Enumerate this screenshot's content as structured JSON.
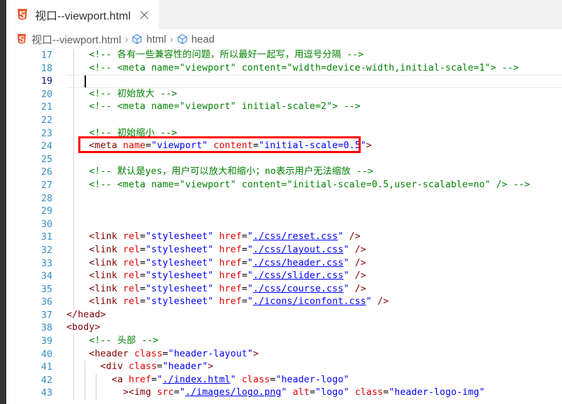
{
  "window": {
    "activity_bar_color": "#333333",
    "tab_bar_color": "#f3f3f3",
    "editor_background": "#ffffff"
  },
  "tab": {
    "icon": "html5-icon",
    "label": "视口--viewport.html",
    "close_icon": "close-icon",
    "active": true
  },
  "breadcrumb": {
    "file_icon": "html5-icon",
    "items": [
      {
        "label": "视口--viewport.html",
        "icon": "html5-icon"
      },
      {
        "label": "html",
        "icon": "symbol-cube-icon"
      },
      {
        "label": "head",
        "icon": "symbol-cube-icon"
      }
    ],
    "separator": "›"
  },
  "annotation": {
    "type": "red-rectangle-highlight",
    "color": "#ff0000",
    "target_line": 24
  },
  "editor": {
    "language": "html",
    "active_line": 19,
    "cursor": {
      "line": 19,
      "column": 2
    },
    "first_visible_line": 17,
    "last_visible_line": 43,
    "colors": {
      "line_number": "#3790c7",
      "active_line_number": "#0b216f",
      "comment": "#008000",
      "tag": "#800000",
      "attribute": "#e50000",
      "string": "#0000ff",
      "text": "#000000"
    },
    "lines": [
      {
        "no": "17",
        "indent": 1,
        "tokens": [
          {
            "c": "comment",
            "t": "    <!-- 各有一些兼容性的问题，所以最好一起写，用逗号分隔 -->"
          }
        ]
      },
      {
        "no": "18",
        "indent": 1,
        "tokens": [
          {
            "c": "comment",
            "t": "    <!-- <meta name=\"viewport\" content=\"width=device-width,initial-scale=1\"> -->"
          }
        ]
      },
      {
        "no": "19",
        "indent": 1,
        "active": true,
        "tokens": [
          {
            "c": "plain",
            "t": ""
          }
        ]
      },
      {
        "no": "20",
        "indent": 1,
        "tokens": [
          {
            "c": "comment",
            "t": "    <!-- 初始放大 -->"
          }
        ]
      },
      {
        "no": "21",
        "indent": 1,
        "tokens": [
          {
            "c": "comment",
            "t": "    <!-- <meta name=\"viewport\" initial-scale=2\"> -->"
          }
        ]
      },
      {
        "no": "22",
        "indent": 1,
        "tokens": [
          {
            "c": "plain",
            "t": ""
          }
        ]
      },
      {
        "no": "23",
        "indent": 1,
        "tokens": [
          {
            "c": "comment",
            "t": "    <!-- 初始缩小 -->"
          }
        ]
      },
      {
        "no": "24",
        "indent": 1,
        "highlighted": true,
        "tokens": [
          {
            "c": "plain",
            "t": "    "
          },
          {
            "c": "punct",
            "t": "<"
          },
          {
            "c": "tag",
            "t": "meta"
          },
          {
            "c": "plain",
            "t": " "
          },
          {
            "c": "attr",
            "t": "name"
          },
          {
            "c": "plain",
            "t": "="
          },
          {
            "c": "str",
            "t": "\"viewport\""
          },
          {
            "c": "plain",
            "t": " "
          },
          {
            "c": "attr",
            "t": "content"
          },
          {
            "c": "plain",
            "t": "="
          },
          {
            "c": "str",
            "t": "\"initial-scale=0.5\""
          },
          {
            "c": "punct",
            "t": ">"
          }
        ]
      },
      {
        "no": "25",
        "indent": 1,
        "tokens": [
          {
            "c": "plain",
            "t": ""
          }
        ]
      },
      {
        "no": "26",
        "indent": 1,
        "tokens": [
          {
            "c": "comment",
            "t": "    <!-- 默认是yes，用户可以放大和缩小；no表示用户无法缩放 -->"
          }
        ]
      },
      {
        "no": "27",
        "indent": 1,
        "tokens": [
          {
            "c": "comment",
            "t": "    <!-- <meta name=\"viewport\" content=\"initial-scale=0.5,user-scalable=no\" /> -->"
          }
        ]
      },
      {
        "no": "28",
        "indent": 1,
        "tokens": [
          {
            "c": "plain",
            "t": ""
          }
        ]
      },
      {
        "no": "29",
        "indent": 1,
        "tokens": [
          {
            "c": "plain",
            "t": ""
          }
        ]
      },
      {
        "no": "30",
        "indent": 1,
        "tokens": [
          {
            "c": "plain",
            "t": ""
          }
        ]
      },
      {
        "no": "31",
        "indent": 1,
        "tokens": [
          {
            "c": "plain",
            "t": "    "
          },
          {
            "c": "punct",
            "t": "<"
          },
          {
            "c": "tag",
            "t": "link"
          },
          {
            "c": "plain",
            "t": " "
          },
          {
            "c": "attr",
            "t": "rel"
          },
          {
            "c": "plain",
            "t": "="
          },
          {
            "c": "str",
            "t": "\"stylesheet\""
          },
          {
            "c": "plain",
            "t": " "
          },
          {
            "c": "attr",
            "t": "href"
          },
          {
            "c": "plain",
            "t": "="
          },
          {
            "c": "str",
            "t": "\""
          },
          {
            "c": "strlink",
            "t": "./css/reset.css"
          },
          {
            "c": "str",
            "t": "\""
          },
          {
            "c": "plain",
            "t": " "
          },
          {
            "c": "punct",
            "t": "/>"
          }
        ]
      },
      {
        "no": "32",
        "indent": 1,
        "tokens": [
          {
            "c": "plain",
            "t": "    "
          },
          {
            "c": "punct",
            "t": "<"
          },
          {
            "c": "tag",
            "t": "link"
          },
          {
            "c": "plain",
            "t": " "
          },
          {
            "c": "attr",
            "t": "rel"
          },
          {
            "c": "plain",
            "t": "="
          },
          {
            "c": "str",
            "t": "\"stylesheet\""
          },
          {
            "c": "plain",
            "t": " "
          },
          {
            "c": "attr",
            "t": "href"
          },
          {
            "c": "plain",
            "t": "="
          },
          {
            "c": "str",
            "t": "\""
          },
          {
            "c": "strlink",
            "t": "./css/layout.css"
          },
          {
            "c": "str",
            "t": "\""
          },
          {
            "c": "plain",
            "t": " "
          },
          {
            "c": "punct",
            "t": "/>"
          }
        ]
      },
      {
        "no": "33",
        "indent": 1,
        "tokens": [
          {
            "c": "plain",
            "t": "    "
          },
          {
            "c": "punct",
            "t": "<"
          },
          {
            "c": "tag",
            "t": "link"
          },
          {
            "c": "plain",
            "t": " "
          },
          {
            "c": "attr",
            "t": "rel"
          },
          {
            "c": "plain",
            "t": "="
          },
          {
            "c": "str",
            "t": "\"stylesheet\""
          },
          {
            "c": "plain",
            "t": " "
          },
          {
            "c": "attr",
            "t": "href"
          },
          {
            "c": "plain",
            "t": "="
          },
          {
            "c": "str",
            "t": "\""
          },
          {
            "c": "strlink",
            "t": "./css/header.css"
          },
          {
            "c": "str",
            "t": "\""
          },
          {
            "c": "plain",
            "t": " "
          },
          {
            "c": "punct",
            "t": "/>"
          }
        ]
      },
      {
        "no": "34",
        "indent": 1,
        "tokens": [
          {
            "c": "plain",
            "t": "    "
          },
          {
            "c": "punct",
            "t": "<"
          },
          {
            "c": "tag",
            "t": "link"
          },
          {
            "c": "plain",
            "t": " "
          },
          {
            "c": "attr",
            "t": "rel"
          },
          {
            "c": "plain",
            "t": "="
          },
          {
            "c": "str",
            "t": "\"stylesheet\""
          },
          {
            "c": "plain",
            "t": " "
          },
          {
            "c": "attr",
            "t": "href"
          },
          {
            "c": "plain",
            "t": "="
          },
          {
            "c": "str",
            "t": "\""
          },
          {
            "c": "strlink",
            "t": "./css/slider.css"
          },
          {
            "c": "str",
            "t": "\""
          },
          {
            "c": "plain",
            "t": " "
          },
          {
            "c": "punct",
            "t": "/>"
          }
        ]
      },
      {
        "no": "35",
        "indent": 1,
        "tokens": [
          {
            "c": "plain",
            "t": "    "
          },
          {
            "c": "punct",
            "t": "<"
          },
          {
            "c": "tag",
            "t": "link"
          },
          {
            "c": "plain",
            "t": " "
          },
          {
            "c": "attr",
            "t": "rel"
          },
          {
            "c": "plain",
            "t": "="
          },
          {
            "c": "str",
            "t": "\"stylesheet\""
          },
          {
            "c": "plain",
            "t": " "
          },
          {
            "c": "attr",
            "t": "href"
          },
          {
            "c": "plain",
            "t": "="
          },
          {
            "c": "str",
            "t": "\""
          },
          {
            "c": "strlink",
            "t": "./css/course.css"
          },
          {
            "c": "str",
            "t": "\""
          },
          {
            "c": "plain",
            "t": " "
          },
          {
            "c": "punct",
            "t": "/>"
          }
        ]
      },
      {
        "no": "36",
        "indent": 1,
        "tokens": [
          {
            "c": "plain",
            "t": "    "
          },
          {
            "c": "punct",
            "t": "<"
          },
          {
            "c": "tag",
            "t": "link"
          },
          {
            "c": "plain",
            "t": " "
          },
          {
            "c": "attr",
            "t": "rel"
          },
          {
            "c": "plain",
            "t": "="
          },
          {
            "c": "str",
            "t": "\"stylesheet\""
          },
          {
            "c": "plain",
            "t": " "
          },
          {
            "c": "attr",
            "t": "href"
          },
          {
            "c": "plain",
            "t": "="
          },
          {
            "c": "str",
            "t": "\""
          },
          {
            "c": "strlink",
            "t": "./icons/iconfont.css"
          },
          {
            "c": "str",
            "t": "\""
          },
          {
            "c": "plain",
            "t": " "
          },
          {
            "c": "punct",
            "t": "/>"
          }
        ]
      },
      {
        "no": "37",
        "indent": 0,
        "tokens": [
          {
            "c": "punct",
            "t": "</"
          },
          {
            "c": "tag",
            "t": "head"
          },
          {
            "c": "punct",
            "t": ">"
          }
        ]
      },
      {
        "no": "38",
        "indent": 0,
        "tokens": [
          {
            "c": "punct",
            "t": "<"
          },
          {
            "c": "tag",
            "t": "body"
          },
          {
            "c": "punct",
            "t": ">"
          }
        ]
      },
      {
        "no": "39",
        "indent": 1,
        "tokens": [
          {
            "c": "comment",
            "t": "    <!-- 头部 -->"
          }
        ]
      },
      {
        "no": "40",
        "indent": 1,
        "tokens": [
          {
            "c": "plain",
            "t": "    "
          },
          {
            "c": "punct",
            "t": "<"
          },
          {
            "c": "tag",
            "t": "header"
          },
          {
            "c": "plain",
            "t": " "
          },
          {
            "c": "attr",
            "t": "class"
          },
          {
            "c": "plain",
            "t": "="
          },
          {
            "c": "str",
            "t": "\"header-layout\""
          },
          {
            "c": "punct",
            "t": ">"
          }
        ]
      },
      {
        "no": "41",
        "indent": 2,
        "tokens": [
          {
            "c": "plain",
            "t": "      "
          },
          {
            "c": "punct",
            "t": "<"
          },
          {
            "c": "tag",
            "t": "div"
          },
          {
            "c": "plain",
            "t": " "
          },
          {
            "c": "attr",
            "t": "class"
          },
          {
            "c": "plain",
            "t": "="
          },
          {
            "c": "str",
            "t": "\"header\""
          },
          {
            "c": "punct",
            "t": ">"
          }
        ]
      },
      {
        "no": "42",
        "indent": 3,
        "tokens": [
          {
            "c": "plain",
            "t": "        "
          },
          {
            "c": "punct",
            "t": "<"
          },
          {
            "c": "tag",
            "t": "a"
          },
          {
            "c": "plain",
            "t": " "
          },
          {
            "c": "attr",
            "t": "href"
          },
          {
            "c": "plain",
            "t": "="
          },
          {
            "c": "str",
            "t": "\""
          },
          {
            "c": "strlink",
            "t": "./index.html"
          },
          {
            "c": "str",
            "t": "\""
          },
          {
            "c": "plain",
            "t": " "
          },
          {
            "c": "attr",
            "t": "class"
          },
          {
            "c": "plain",
            "t": "="
          },
          {
            "c": "str",
            "t": "\"header-logo\""
          }
        ]
      },
      {
        "no": "43",
        "indent": 3,
        "tokens": [
          {
            "c": "plain",
            "t": "          "
          },
          {
            "c": "punct",
            "t": "><"
          },
          {
            "c": "tag",
            "t": "img"
          },
          {
            "c": "plain",
            "t": " "
          },
          {
            "c": "attr",
            "t": "src"
          },
          {
            "c": "plain",
            "t": "="
          },
          {
            "c": "str",
            "t": "\""
          },
          {
            "c": "strlink",
            "t": "./images/logo.png"
          },
          {
            "c": "str",
            "t": "\""
          },
          {
            "c": "plain",
            "t": " "
          },
          {
            "c": "attr",
            "t": "alt"
          },
          {
            "c": "plain",
            "t": "="
          },
          {
            "c": "str",
            "t": "\"logo\""
          },
          {
            "c": "plain",
            "t": " "
          },
          {
            "c": "attr",
            "t": "class"
          },
          {
            "c": "plain",
            "t": "="
          },
          {
            "c": "str",
            "t": "\"header-logo-img\""
          }
        ]
      }
    ]
  }
}
